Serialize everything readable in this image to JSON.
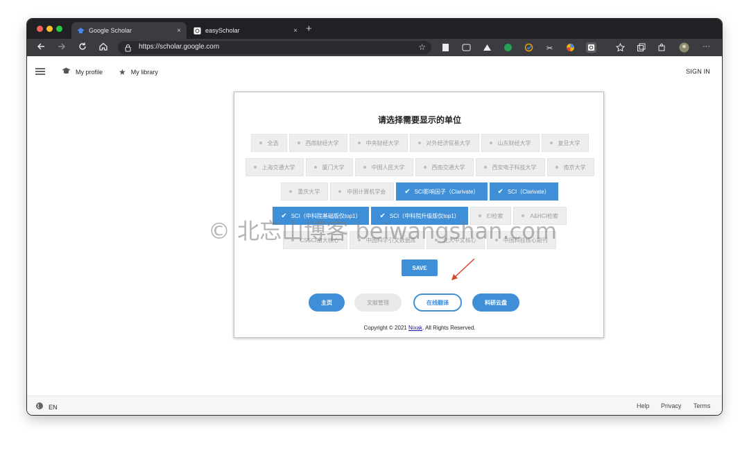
{
  "browser": {
    "tabs": [
      {
        "title": "Google Scholar",
        "active": true
      },
      {
        "title": "easyScholar",
        "active": false
      }
    ],
    "url": "https://scholar.google.com",
    "close_glyph": "×",
    "new_tab_glyph": "+"
  },
  "scholar": {
    "my_profile": "My profile",
    "my_library": "My library",
    "sign_in": "SIGN IN",
    "footer": {
      "language": "EN",
      "links": [
        "Help",
        "Privacy",
        "Terms"
      ]
    }
  },
  "popup": {
    "title": "请选择需要显示的单位",
    "rows": [
      [
        {
          "label": "全选",
          "selected": false
        },
        {
          "label": "西南财经大学",
          "selected": false
        },
        {
          "label": "中央财经大学",
          "selected": false
        },
        {
          "label": "对外经济贸易大学",
          "selected": false
        },
        {
          "label": "山东财经大学",
          "selected": false
        },
        {
          "label": "复旦大学",
          "selected": false
        }
      ],
      [
        {
          "label": "上海交通大学",
          "selected": false
        },
        {
          "label": "厦门大学",
          "selected": false
        },
        {
          "label": "中国人民大学",
          "selected": false
        },
        {
          "label": "西南交通大学",
          "selected": false
        },
        {
          "label": "西安电子科技大学",
          "selected": false
        },
        {
          "label": "南京大学",
          "selected": false
        }
      ],
      [
        {
          "label": "重庆大学",
          "selected": false
        },
        {
          "label": "中国计算机学会",
          "selected": false
        },
        {
          "label": "SCI影响因子（Clarivate）",
          "selected": true
        },
        {
          "label": "SCI（Clarivate）",
          "selected": true
        }
      ],
      [
        {
          "label": "SCI（中科院基础版仅top1）",
          "selected": true
        },
        {
          "label": "SCI（中科院升级版仅top1）",
          "selected": true
        },
        {
          "label": "EI检索",
          "selected": false
        },
        {
          "label": "A&HCI检索",
          "selected": false
        }
      ],
      [
        {
          "label": "CSSCI南大核心",
          "selected": false
        },
        {
          "label": "中国科学引文数据库",
          "selected": false
        },
        {
          "label": "北大中文核心",
          "selected": false
        },
        {
          "label": "中国科技核心期刊",
          "selected": false
        }
      ]
    ],
    "save_label": "SAVE",
    "nav_buttons": [
      "主页",
      "文献管理",
      "在线翻译",
      "科研云盘"
    ],
    "copyright_prefix": "Copyright © 2021",
    "copyright_link": "Nixak",
    "copyright_suffix": ". All Rights Reserved."
  },
  "watermark": "© 北忘山博客 beiwangshan.com",
  "colors": {
    "accent": "#3f8fd8",
    "chip_gray": "#eeeeee",
    "browser_dark": "#202124"
  }
}
